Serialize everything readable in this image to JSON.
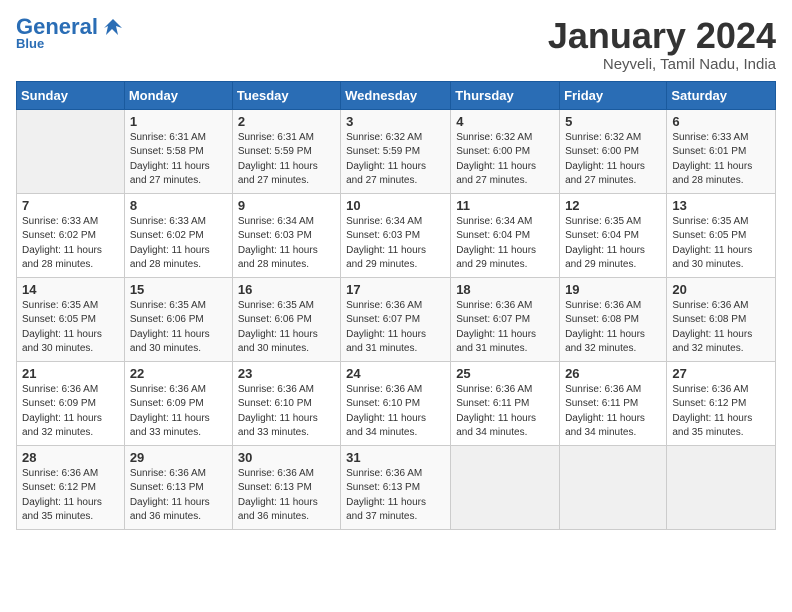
{
  "logo": {
    "general": "General",
    "blue": "Blue",
    "tagline": ""
  },
  "calendar": {
    "title": "January 2024",
    "subtitle": "Neyveli, Tamil Nadu, India"
  },
  "headers": [
    "Sunday",
    "Monday",
    "Tuesday",
    "Wednesday",
    "Thursday",
    "Friday",
    "Saturday"
  ],
  "weeks": [
    [
      {
        "num": "",
        "info": ""
      },
      {
        "num": "1",
        "info": "Sunrise: 6:31 AM\nSunset: 5:58 PM\nDaylight: 11 hours\nand 27 minutes."
      },
      {
        "num": "2",
        "info": "Sunrise: 6:31 AM\nSunset: 5:59 PM\nDaylight: 11 hours\nand 27 minutes."
      },
      {
        "num": "3",
        "info": "Sunrise: 6:32 AM\nSunset: 5:59 PM\nDaylight: 11 hours\nand 27 minutes."
      },
      {
        "num": "4",
        "info": "Sunrise: 6:32 AM\nSunset: 6:00 PM\nDaylight: 11 hours\nand 27 minutes."
      },
      {
        "num": "5",
        "info": "Sunrise: 6:32 AM\nSunset: 6:00 PM\nDaylight: 11 hours\nand 27 minutes."
      },
      {
        "num": "6",
        "info": "Sunrise: 6:33 AM\nSunset: 6:01 PM\nDaylight: 11 hours\nand 28 minutes."
      }
    ],
    [
      {
        "num": "7",
        "info": "Sunrise: 6:33 AM\nSunset: 6:02 PM\nDaylight: 11 hours\nand 28 minutes."
      },
      {
        "num": "8",
        "info": "Sunrise: 6:33 AM\nSunset: 6:02 PM\nDaylight: 11 hours\nand 28 minutes."
      },
      {
        "num": "9",
        "info": "Sunrise: 6:34 AM\nSunset: 6:03 PM\nDaylight: 11 hours\nand 28 minutes."
      },
      {
        "num": "10",
        "info": "Sunrise: 6:34 AM\nSunset: 6:03 PM\nDaylight: 11 hours\nand 29 minutes."
      },
      {
        "num": "11",
        "info": "Sunrise: 6:34 AM\nSunset: 6:04 PM\nDaylight: 11 hours\nand 29 minutes."
      },
      {
        "num": "12",
        "info": "Sunrise: 6:35 AM\nSunset: 6:04 PM\nDaylight: 11 hours\nand 29 minutes."
      },
      {
        "num": "13",
        "info": "Sunrise: 6:35 AM\nSunset: 6:05 PM\nDaylight: 11 hours\nand 30 minutes."
      }
    ],
    [
      {
        "num": "14",
        "info": "Sunrise: 6:35 AM\nSunset: 6:05 PM\nDaylight: 11 hours\nand 30 minutes."
      },
      {
        "num": "15",
        "info": "Sunrise: 6:35 AM\nSunset: 6:06 PM\nDaylight: 11 hours\nand 30 minutes."
      },
      {
        "num": "16",
        "info": "Sunrise: 6:35 AM\nSunset: 6:06 PM\nDaylight: 11 hours\nand 30 minutes."
      },
      {
        "num": "17",
        "info": "Sunrise: 6:36 AM\nSunset: 6:07 PM\nDaylight: 11 hours\nand 31 minutes."
      },
      {
        "num": "18",
        "info": "Sunrise: 6:36 AM\nSunset: 6:07 PM\nDaylight: 11 hours\nand 31 minutes."
      },
      {
        "num": "19",
        "info": "Sunrise: 6:36 AM\nSunset: 6:08 PM\nDaylight: 11 hours\nand 32 minutes."
      },
      {
        "num": "20",
        "info": "Sunrise: 6:36 AM\nSunset: 6:08 PM\nDaylight: 11 hours\nand 32 minutes."
      }
    ],
    [
      {
        "num": "21",
        "info": "Sunrise: 6:36 AM\nSunset: 6:09 PM\nDaylight: 11 hours\nand 32 minutes."
      },
      {
        "num": "22",
        "info": "Sunrise: 6:36 AM\nSunset: 6:09 PM\nDaylight: 11 hours\nand 33 minutes."
      },
      {
        "num": "23",
        "info": "Sunrise: 6:36 AM\nSunset: 6:10 PM\nDaylight: 11 hours\nand 33 minutes."
      },
      {
        "num": "24",
        "info": "Sunrise: 6:36 AM\nSunset: 6:10 PM\nDaylight: 11 hours\nand 34 minutes."
      },
      {
        "num": "25",
        "info": "Sunrise: 6:36 AM\nSunset: 6:11 PM\nDaylight: 11 hours\nand 34 minutes."
      },
      {
        "num": "26",
        "info": "Sunrise: 6:36 AM\nSunset: 6:11 PM\nDaylight: 11 hours\nand 34 minutes."
      },
      {
        "num": "27",
        "info": "Sunrise: 6:36 AM\nSunset: 6:12 PM\nDaylight: 11 hours\nand 35 minutes."
      }
    ],
    [
      {
        "num": "28",
        "info": "Sunrise: 6:36 AM\nSunset: 6:12 PM\nDaylight: 11 hours\nand 35 minutes."
      },
      {
        "num": "29",
        "info": "Sunrise: 6:36 AM\nSunset: 6:13 PM\nDaylight: 11 hours\nand 36 minutes."
      },
      {
        "num": "30",
        "info": "Sunrise: 6:36 AM\nSunset: 6:13 PM\nDaylight: 11 hours\nand 36 minutes."
      },
      {
        "num": "31",
        "info": "Sunrise: 6:36 AM\nSunset: 6:13 PM\nDaylight: 11 hours\nand 37 minutes."
      },
      {
        "num": "",
        "info": ""
      },
      {
        "num": "",
        "info": ""
      },
      {
        "num": "",
        "info": ""
      }
    ]
  ]
}
